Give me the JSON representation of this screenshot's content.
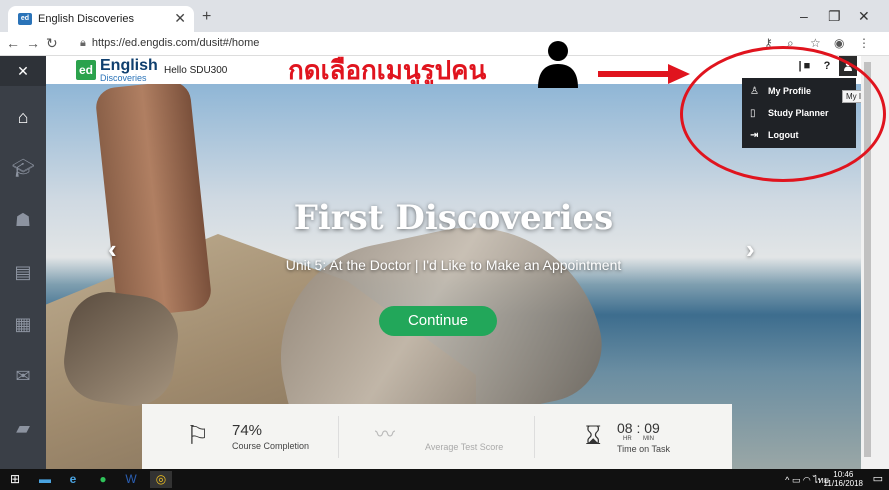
{
  "browser": {
    "tab_title": "English Discoveries",
    "tab_favicon": "ed",
    "url": "https://ed.engdis.com/dusit#/home",
    "controls": {
      "minimize": "–",
      "maximize": "❐",
      "close": "✕",
      "new_tab": "+"
    }
  },
  "header": {
    "logo_mark": "ed",
    "logo_text": "English",
    "logo_subtext": "Discoveries",
    "greeting": "Hello SDU300"
  },
  "annotation": {
    "text": "กดเลือกเมนูรูปคน",
    "color": "#e0141e"
  },
  "user_menu": {
    "tooltip": "My Info",
    "items": [
      {
        "label": "My Profile",
        "icon": "user-outline-icon"
      },
      {
        "label": "Study Planner",
        "icon": "planner-icon"
      },
      {
        "label": "Logout",
        "icon": "logout-icon"
      }
    ]
  },
  "hero": {
    "title": "First Discoveries",
    "subtitle": "Unit 5: At the Doctor | I'd Like to Make an Appointment",
    "cta": "Continue"
  },
  "stats": {
    "completion_value": "74%",
    "completion_label": "Course Completion",
    "test_label": "Average Test Score",
    "time_value": "08 : 09",
    "time_hr": "HR",
    "time_min": "MIN",
    "time_label": "Time on Task"
  },
  "taskbar": {
    "time": "10:46",
    "date": "11/16/2018",
    "lang": "ไทย"
  },
  "colors": {
    "sidebar": "#3a3f47",
    "cta_green": "#22a75a",
    "menu_bg": "#1f2226",
    "logo_green": "#2ba24c"
  }
}
